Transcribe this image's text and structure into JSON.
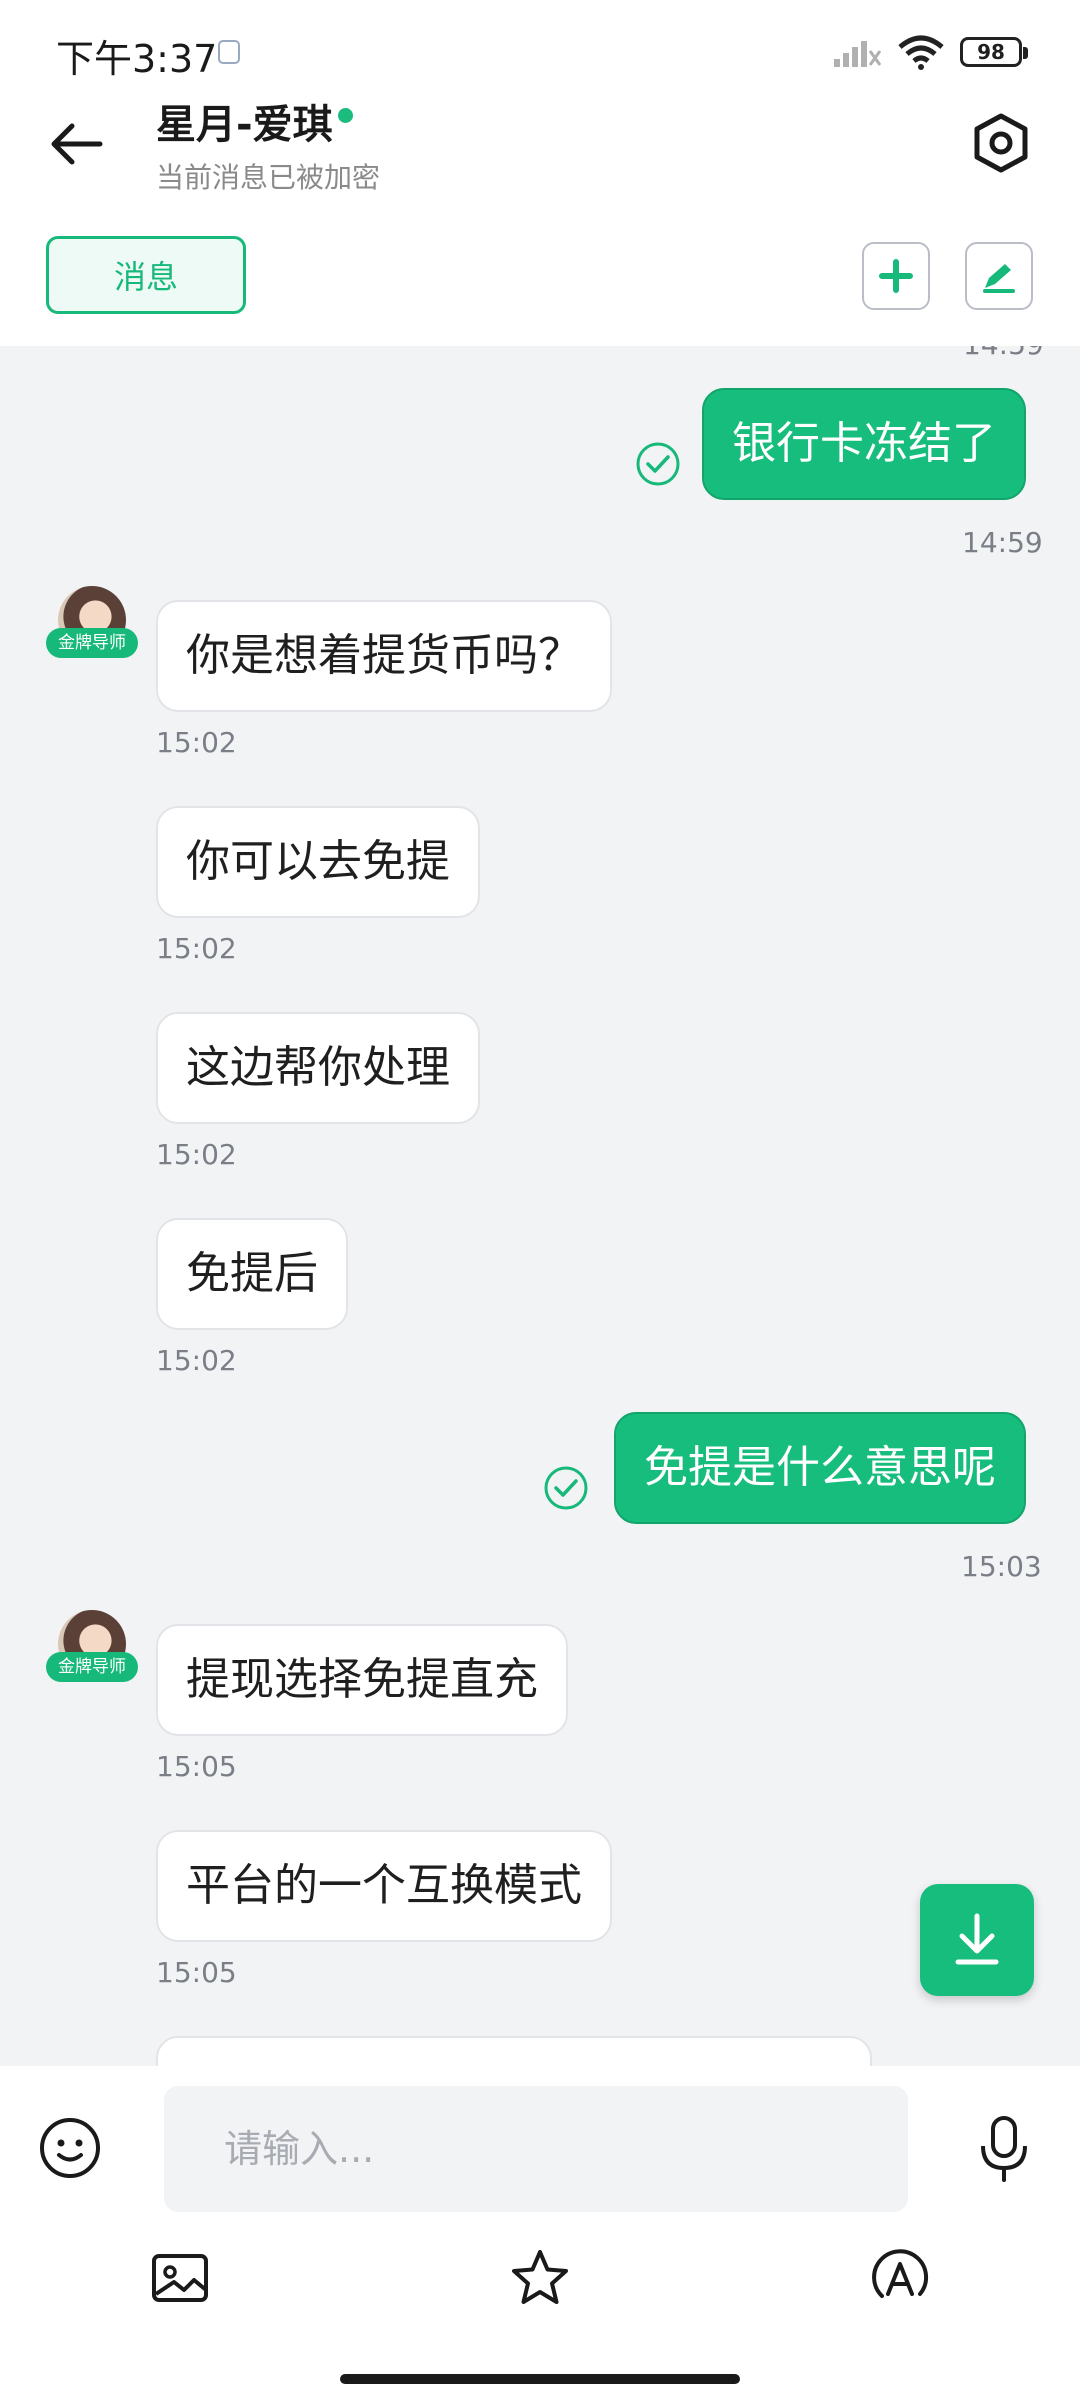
{
  "status_bar": {
    "time": "下午3:37",
    "battery": "98"
  },
  "header": {
    "contact_name": "星月-爱琪",
    "subtitle": "当前消息已被加密"
  },
  "tabs": {
    "messages_label": "消息"
  },
  "messages": [
    {
      "id": "m0",
      "side": "out",
      "text": "银行卡冻结了",
      "time": "14:59"
    },
    {
      "id": "m1",
      "side": "in",
      "text": "你是想着提货币吗？",
      "time": "15:02"
    },
    {
      "id": "m2",
      "side": "in",
      "text": "你可以去免提",
      "time": "15:02"
    },
    {
      "id": "m3",
      "side": "in",
      "text": "这边帮你处理",
      "time": "15:02"
    },
    {
      "id": "m4",
      "side": "in",
      "text": "免提后",
      "time": "15:02"
    },
    {
      "id": "m5",
      "side": "out",
      "text": "免提是什么意思呢",
      "time": "15:03"
    },
    {
      "id": "m6",
      "side": "in",
      "text": "提现选择免提直充",
      "time": "15:05"
    },
    {
      "id": "m7",
      "side": "in",
      "text": "平台的一个互换模式",
      "time": "15:05"
    }
  ],
  "partial_top_timestamp": "14:59",
  "avatar_badge": "金牌导师",
  "input": {
    "placeholder": "请输入..."
  },
  "colors": {
    "accent": "#17bd7d",
    "background": "#f2f3f5"
  }
}
